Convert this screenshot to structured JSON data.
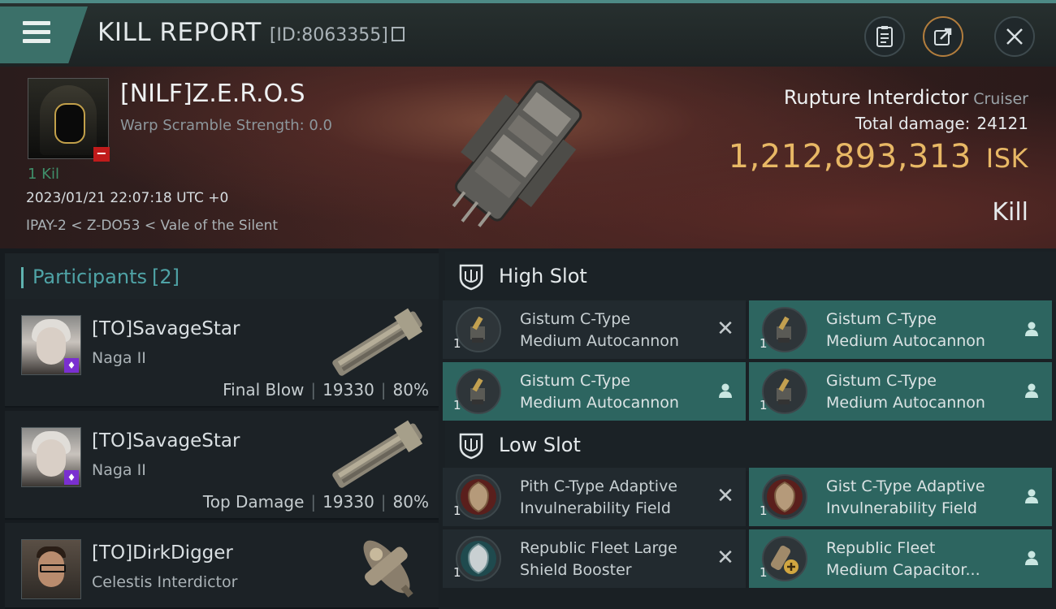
{
  "header": {
    "title": "KILL REPORT",
    "report_id": "[ID:8063355]",
    "icons": [
      "menu-icon",
      "clipboard-icon",
      "share-icon",
      "close-icon"
    ]
  },
  "victim": {
    "name": "[NILF]Z.E.R.O.S",
    "warp_scramble": "Warp Scramble Strength: 0.0",
    "kills_label": "1 Kil",
    "datetime": "2023/01/21 22:07:18 UTC +0",
    "location": "IPAY-2 < Z-DO53 < Vale of the Silent",
    "ship_name": "Rupture Interdictor",
    "ship_class": "Cruiser",
    "total_damage_label": "Total damage:",
    "total_damage": "24121",
    "isk_value": "1,212,893,313",
    "isk_unit": "ISK",
    "result": "Kill"
  },
  "participants": {
    "title": "Participants",
    "count": "[2]",
    "rows": [
      {
        "name": "[TO]SavageStar",
        "ship": "Naga II",
        "stat_label": "Final Blow",
        "damage": "19330",
        "percent": "80%"
      },
      {
        "name": "[TO]SavageStar",
        "ship": "Naga II",
        "stat_label": "Top Damage",
        "damage": "19330",
        "percent": "80%"
      },
      {
        "name": "[TO]DirkDigger",
        "ship": "Celestis Interdictor"
      }
    ]
  },
  "fittings": {
    "high_slot_label": "High Slot",
    "low_slot_label": "Low Slot",
    "high": [
      {
        "line1": "Gistum C-Type",
        "line2": "Medium Autocannon",
        "qty": "1",
        "status": "destroyed"
      },
      {
        "line1": "Gistum C-Type",
        "line2": "Medium Autocannon",
        "qty": "1",
        "status": "dropped"
      },
      {
        "line1": "Gistum C-Type",
        "line2": "Medium Autocannon",
        "qty": "1",
        "status": "dropped"
      },
      {
        "line1": "Gistum C-Type",
        "line2": "Medium Autocannon",
        "qty": "1",
        "status": "dropped"
      }
    ],
    "low": [
      {
        "line1": "Pith C-Type Adaptive",
        "line2": "Invulnerability Field",
        "qty": "1",
        "status": "destroyed"
      },
      {
        "line1": "Gist C-Type Adaptive",
        "line2": "Invulnerability Field",
        "qty": "1",
        "status": "dropped"
      },
      {
        "line1": "Republic Fleet Large",
        "line2": "Shield Booster",
        "qty": "1",
        "status": "destroyed"
      },
      {
        "line1": "Republic Fleet",
        "line2": "Medium Capacitor...",
        "qty": "1",
        "status": "dropped"
      }
    ]
  },
  "colors": {
    "accent_teal": "#3b7069",
    "highlight_row": "#2d6560",
    "isk_gold": "#e8b865",
    "portrait_badge_red": "#c01b1b",
    "pilot_badge_purple": "#7a2fd0"
  }
}
